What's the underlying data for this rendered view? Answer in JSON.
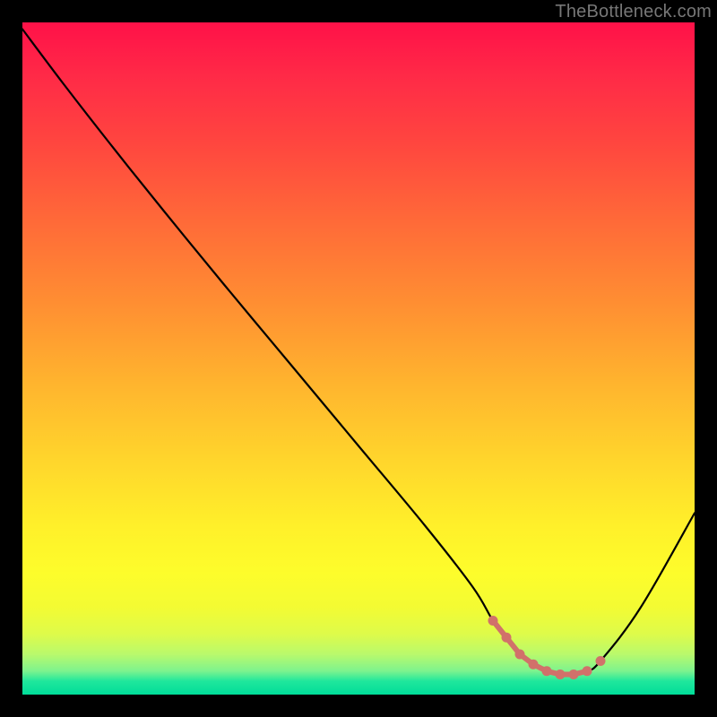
{
  "watermark": "TheBottleneck.com",
  "chart_data": {
    "type": "line",
    "title": "",
    "xlabel": "",
    "ylabel": "",
    "xlim": [
      0,
      100
    ],
    "ylim": [
      0,
      100
    ],
    "grid": false,
    "x": [
      0,
      6,
      13,
      21,
      30,
      40,
      50,
      60,
      67,
      70,
      72,
      74,
      76,
      78,
      80,
      82,
      84,
      86,
      92,
      100
    ],
    "y": [
      99,
      91,
      82,
      72,
      61,
      49,
      37,
      25,
      16,
      11,
      8.5,
      6,
      4.5,
      3.5,
      3,
      3,
      3.5,
      5,
      13,
      27
    ],
    "highlight_cap_x_range": [
      70,
      84
    ],
    "highlight_points_x": [
      70,
      72,
      74,
      76,
      78,
      80,
      82,
      84,
      86
    ],
    "colors": {
      "curve": "#000000",
      "highlight": "#d1716a",
      "gradient_top": "#ff1148",
      "gradient_bottom": "#00dd99"
    }
  }
}
